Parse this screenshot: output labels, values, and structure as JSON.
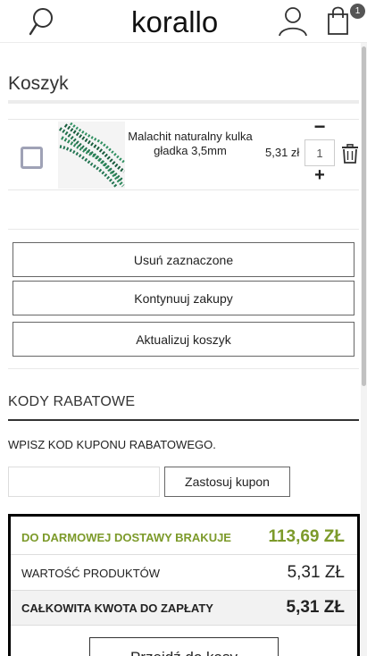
{
  "header": {
    "logo_text": "korallo",
    "cart_count": "1",
    "icons": [
      "search-icon",
      "user-icon",
      "shopping-bag-icon"
    ]
  },
  "cart": {
    "title": "Koszyk",
    "items": [
      {
        "name": "Malachit naturalny kulka gładka 3,5mm",
        "price": "5,31 zł",
        "quantity": "1",
        "qty_minus": "−",
        "qty_plus": "+"
      }
    ]
  },
  "actions": {
    "remove_selected": "Usuń zaznaczone",
    "continue_shopping": "Kontynuuj zakupy",
    "update_cart": "Aktualizuj koszyk"
  },
  "coupon": {
    "title": "KODY RABATOWE",
    "label": "WPISZ KOD KUPONU RABATOWEGO.",
    "input_value": "",
    "apply_label": "Zastosuj kupon"
  },
  "summary": {
    "free_shipping_label": "DO DARMOWEJ DOSTAWY BRAKUJE",
    "free_shipping_value": "113,69 ZŁ",
    "products_label": "WARTOŚĆ PRODUKTÓW",
    "products_value": "5,31 ZŁ",
    "total_label": "CAŁKOWITA KWOTA DO ZAPŁATY",
    "total_value": "5,31 ZŁ",
    "checkout_label": "Przejdź do kasy"
  },
  "colors": {
    "accent_green": "#7c9a2a",
    "checkbox_border": "#9fa2b6",
    "product_green": "#1f6f4a"
  }
}
